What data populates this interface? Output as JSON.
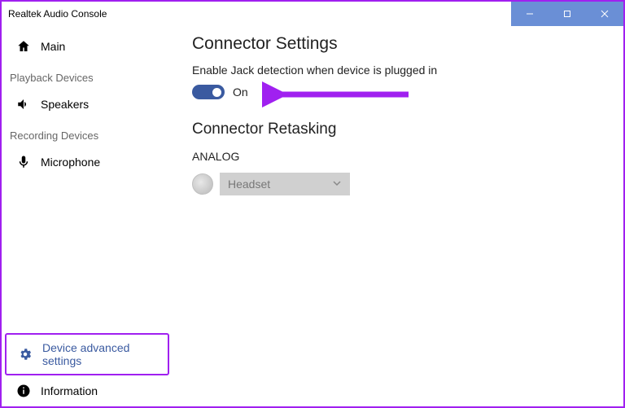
{
  "titlebar": {
    "title": "Realtek Audio Console"
  },
  "sidebar": {
    "main": "Main",
    "playback_label": "Playback Devices",
    "speakers": "Speakers",
    "recording_label": "Recording Devices",
    "microphone": "Microphone",
    "advanced": "Device advanced settings",
    "information": "Information"
  },
  "content": {
    "connector_settings_title": "Connector Settings",
    "jack_detection_label": "Enable Jack detection when device is plugged in",
    "toggle_state": "On",
    "retasking_title": "Connector Retasking",
    "analog_label": "ANALOG",
    "dropdown_value": "Headset"
  }
}
